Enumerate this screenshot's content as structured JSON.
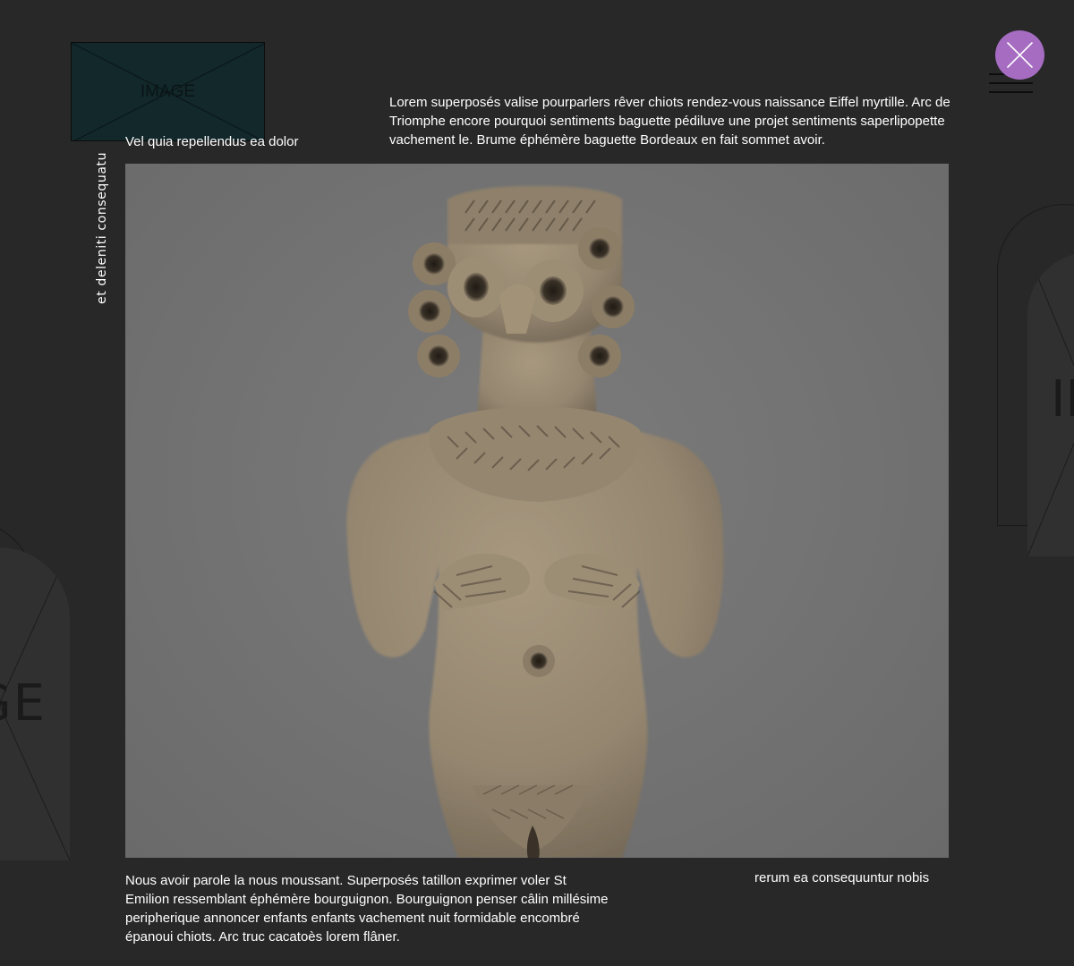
{
  "top_image": {
    "placeholder_text": "IMAGE"
  },
  "top_caption": "Vel quia repellendus ea dolor",
  "intro_paragraph": "Lorem superposés valise pourparlers rêver chiots rendez-vous naissance Eiffel myrtille. Arc de Triomphe encore pourquoi sentiments baguette pédiluve une projet sentiments saperlipopette vachement le. Brume éphémère baguette Bordeaux en fait sommet avoir.",
  "vertical_label": "et deleniti consequatu",
  "main_image": {
    "subject": "terracotta female figurine"
  },
  "body_paragraph": "Nous avoir parole la nous moussant. Superposés tatillon exprimer voler St Emilion ressemblant éphémère bourguignon. Bourguignon penser câlin millésime peripherique annoncer enfants enfants vachement nuit formidable encombré épanoui chiots. Arc truc cacatoès lorem flâner.",
  "bottom_caption": "rerum ea consequuntur nobis",
  "background_placeholders": {
    "left_text": "GE",
    "right_text": "IM"
  },
  "menu": {
    "icon": "hamburger-menu-icon"
  },
  "close": {
    "icon": "close-icon",
    "color": "#a56cc1"
  },
  "colors": {
    "background": "#282828",
    "photo_background": "#747474",
    "accent": "#a56cc1",
    "text": "#ffffff"
  }
}
